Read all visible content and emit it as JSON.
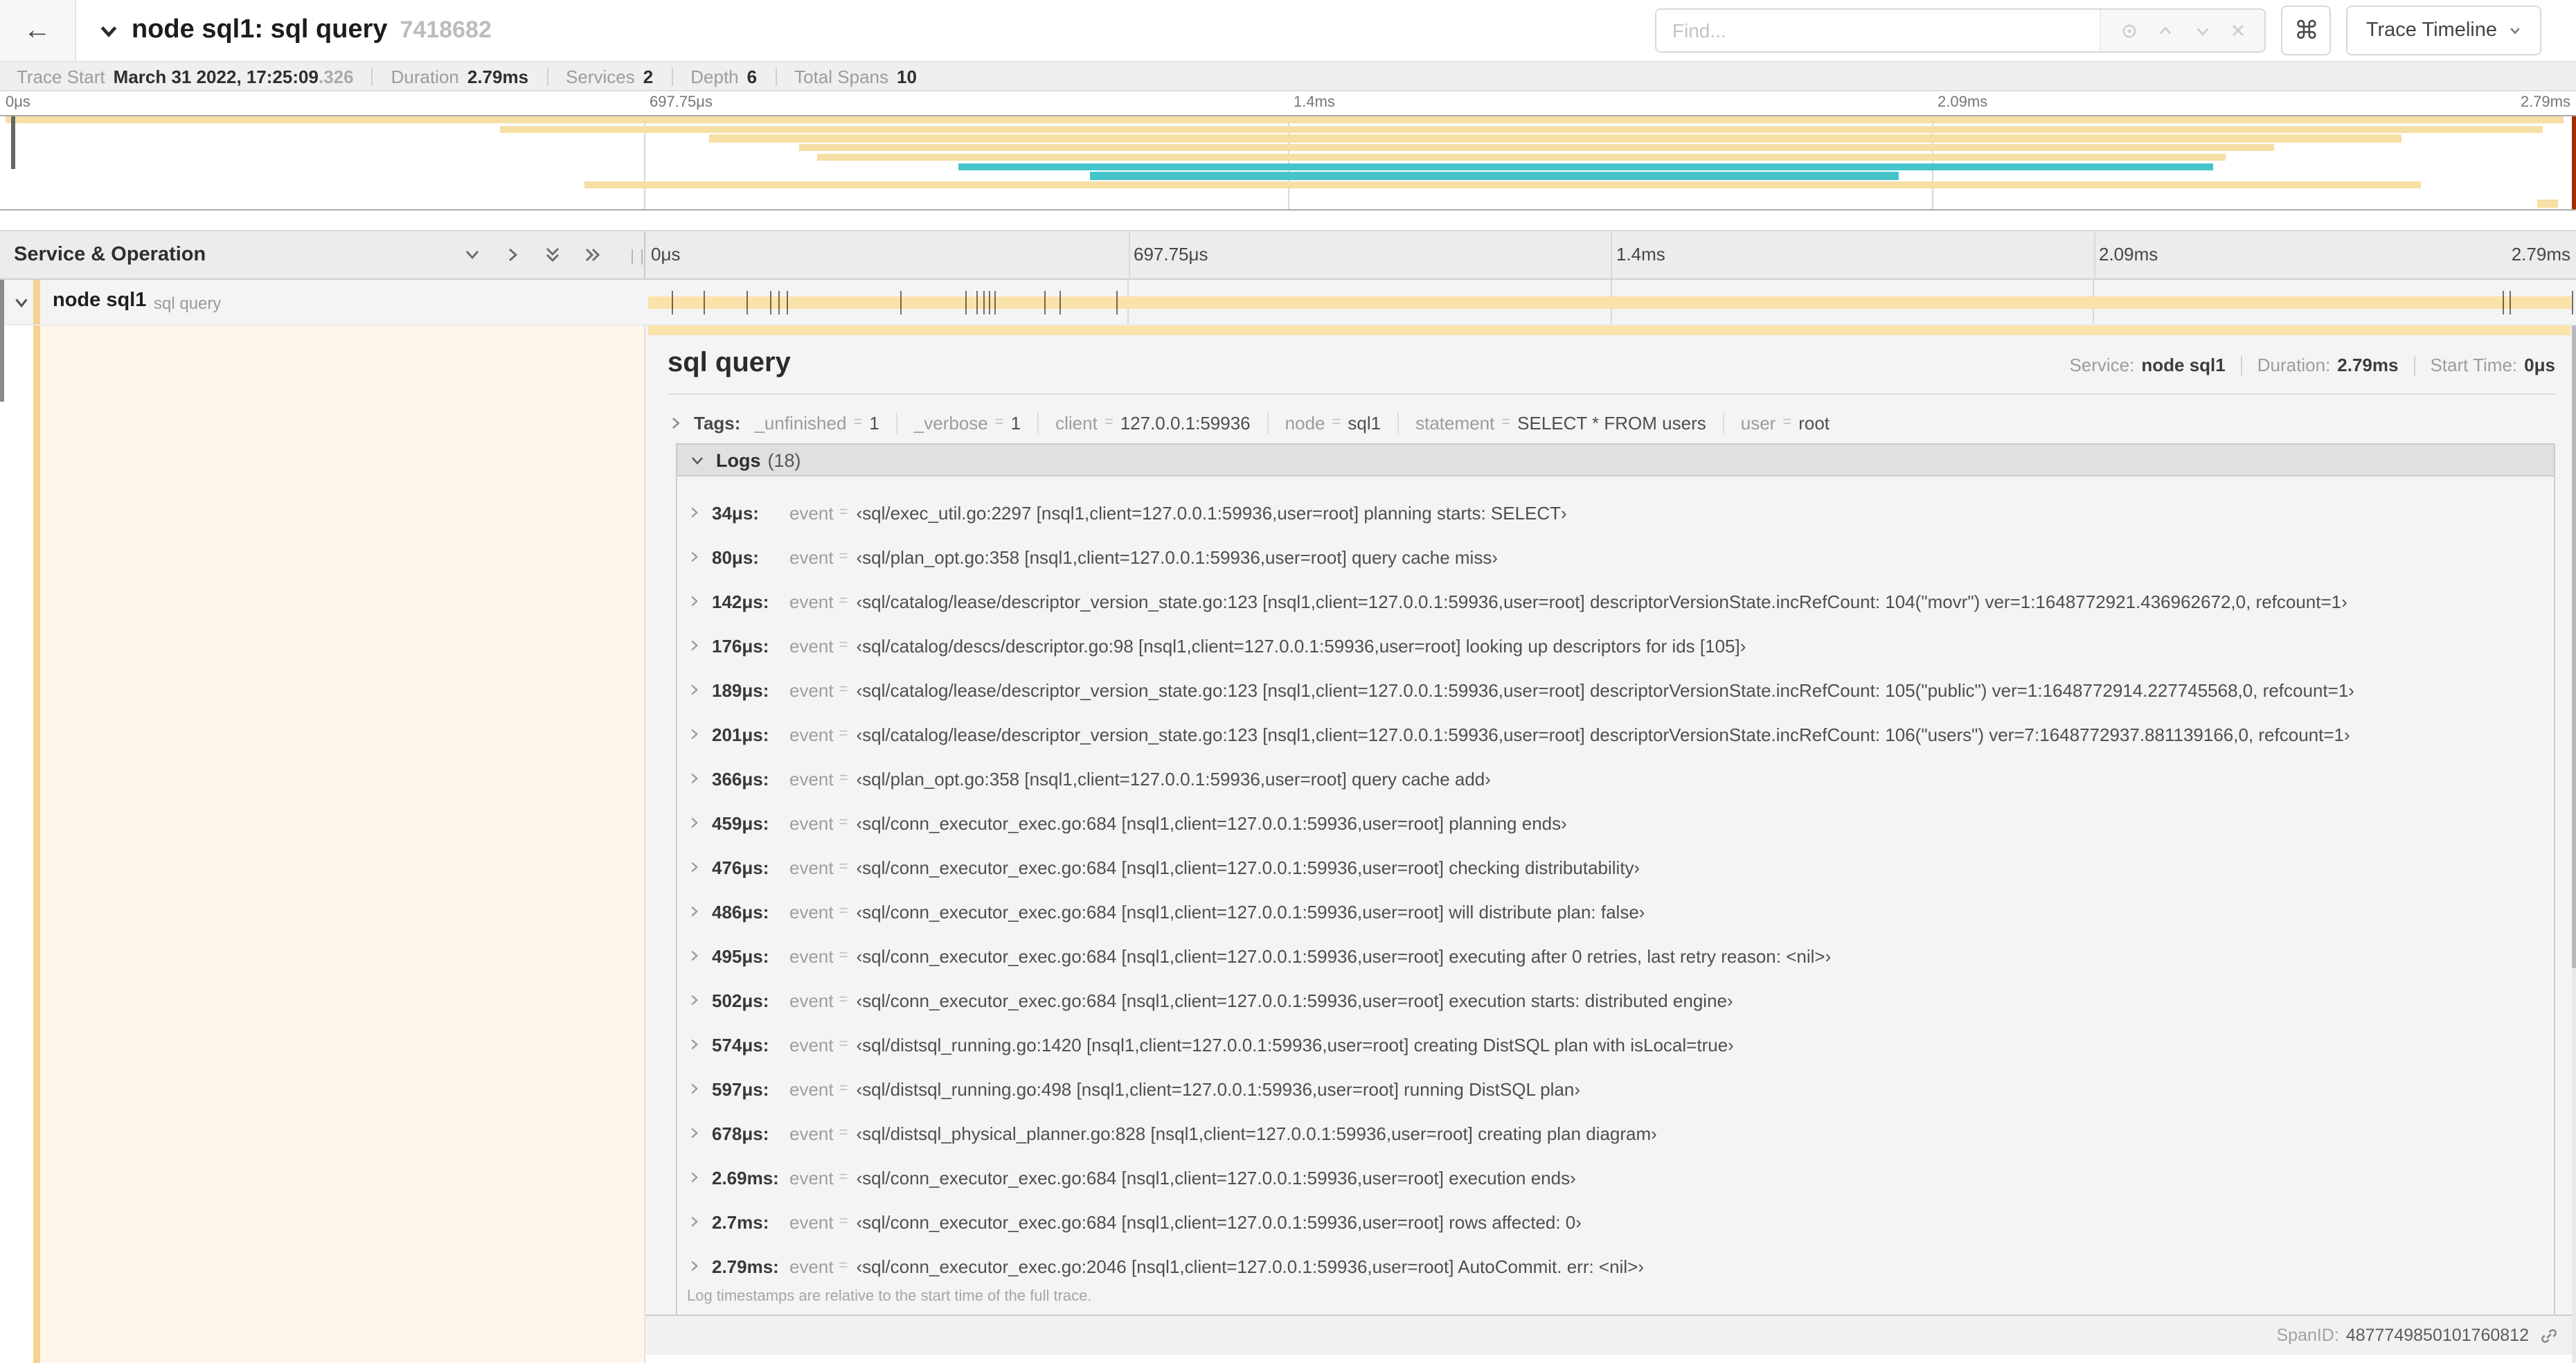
{
  "header": {
    "back": "←",
    "title": "node sql1: sql query",
    "trace_id": "7418682",
    "find_placeholder": "Find...",
    "shortcut_key": "⌘",
    "view_button": "Trace Timeline"
  },
  "stats": [
    {
      "label": "Trace Start",
      "value": "March 31 2022, 17:25:09",
      "suffix": ".326"
    },
    {
      "label": "Duration",
      "value": "2.79ms",
      "suffix": ""
    },
    {
      "label": "Services",
      "value": "2",
      "suffix": ""
    },
    {
      "label": "Depth",
      "value": "6",
      "suffix": ""
    },
    {
      "label": "Total Spans",
      "value": "10",
      "suffix": ""
    }
  ],
  "timeline": {
    "duration_us": 2790,
    "ticks": [
      {
        "label": "0μs",
        "pct": 0
      },
      {
        "label": "697.75μs",
        "pct": 25
      },
      {
        "label": "1.4ms",
        "pct": 50
      },
      {
        "label": "2.09ms",
        "pct": 75
      },
      {
        "label": "2.79ms",
        "pct": 100
      }
    ],
    "log_marks_us": [
      34,
      80,
      142,
      176,
      189,
      201,
      366,
      459,
      476,
      486,
      495,
      502,
      574,
      597,
      678,
      2690,
      2700,
      2790
    ]
  },
  "minimap": {
    "rows": [
      {
        "row": 1,
        "s": 0.2,
        "e": 99.5,
        "c": "y"
      },
      {
        "row": 2,
        "s": 19.4,
        "e": 98.7,
        "c": "y"
      },
      {
        "row": 3,
        "s": 27.5,
        "e": 93.2,
        "c": "y"
      },
      {
        "row": 4,
        "s": 31.0,
        "e": 88.3,
        "c": "y"
      },
      {
        "row": 5,
        "s": 31.7,
        "e": 86.4,
        "c": "y"
      },
      {
        "row": 6,
        "s": 37.2,
        "e": 85.9,
        "c": "t"
      },
      {
        "row": 7,
        "s": 42.3,
        "e": 73.7,
        "c": "t"
      },
      {
        "row": 8,
        "s": 22.7,
        "e": 94.0,
        "c": "y"
      },
      {
        "row": 10,
        "s": 98.5,
        "e": 99.3,
        "c": "y"
      }
    ]
  },
  "tree": {
    "header": "Service & Operation",
    "row": {
      "service": "node sql1",
      "operation": "sql query"
    }
  },
  "detail": {
    "title": "sql query",
    "info": [
      {
        "label": "Service:",
        "value": "node sql1"
      },
      {
        "label": "Duration:",
        "value": "2.79ms"
      },
      {
        "label": "Start Time:",
        "value": "0μs"
      }
    ],
    "tags_label": "Tags:",
    "tags": [
      {
        "k": "_unfinished",
        "v": "1"
      },
      {
        "k": "_verbose",
        "v": "1"
      },
      {
        "k": "client",
        "v": "127.0.0.1:59936"
      },
      {
        "k": "node",
        "v": "sql1"
      },
      {
        "k": "statement",
        "v": "SELECT * FROM users"
      },
      {
        "k": "user",
        "v": "root"
      }
    ],
    "logs_title": "Logs",
    "logs_count": "(18)",
    "log_key": "event",
    "log_eq": "=",
    "logs": [
      {
        "t": "34μs:",
        "v": "‹sql/exec_util.go:2297 [nsql1,client=127.0.0.1:59936,user=root] planning starts: SELECT›"
      },
      {
        "t": "80μs:",
        "v": "‹sql/plan_opt.go:358 [nsql1,client=127.0.0.1:59936,user=root] query cache miss›"
      },
      {
        "t": "142μs:",
        "v": "‹sql/catalog/lease/descriptor_version_state.go:123 [nsql1,client=127.0.0.1:59936,user=root] descriptorVersionState.incRefCount: 104(\"movr\") ver=1:1648772921.436962672,0, refcount=1›"
      },
      {
        "t": "176μs:",
        "v": "‹sql/catalog/descs/descriptor.go:98 [nsql1,client=127.0.0.1:59936,user=root] looking up descriptors for ids [105]›"
      },
      {
        "t": "189μs:",
        "v": "‹sql/catalog/lease/descriptor_version_state.go:123 [nsql1,client=127.0.0.1:59936,user=root] descriptorVersionState.incRefCount: 105(\"public\") ver=1:1648772914.227745568,0, refcount=1›"
      },
      {
        "t": "201μs:",
        "v": "‹sql/catalog/lease/descriptor_version_state.go:123 [nsql1,client=127.0.0.1:59936,user=root] descriptorVersionState.incRefCount: 106(\"users\") ver=7:1648772937.881139166,0, refcount=1›"
      },
      {
        "t": "366μs:",
        "v": "‹sql/plan_opt.go:358 [nsql1,client=127.0.0.1:59936,user=root] query cache add›"
      },
      {
        "t": "459μs:",
        "v": "‹sql/conn_executor_exec.go:684 [nsql1,client=127.0.0.1:59936,user=root] planning ends›"
      },
      {
        "t": "476μs:",
        "v": "‹sql/conn_executor_exec.go:684 [nsql1,client=127.0.0.1:59936,user=root] checking distributability›"
      },
      {
        "t": "486μs:",
        "v": "‹sql/conn_executor_exec.go:684 [nsql1,client=127.0.0.1:59936,user=root] will distribute plan: false›"
      },
      {
        "t": "495μs:",
        "v": "‹sql/conn_executor_exec.go:684 [nsql1,client=127.0.0.1:59936,user=root] executing after 0 retries, last retry reason: <nil>›"
      },
      {
        "t": "502μs:",
        "v": "‹sql/conn_executor_exec.go:684 [nsql1,client=127.0.0.1:59936,user=root] execution starts: distributed engine›"
      },
      {
        "t": "574μs:",
        "v": "‹sql/distsql_running.go:1420 [nsql1,client=127.0.0.1:59936,user=root] creating DistSQL plan with isLocal=true›"
      },
      {
        "t": "597μs:",
        "v": "‹sql/distsql_running.go:498 [nsql1,client=127.0.0.1:59936,user=root] running DistSQL plan›"
      },
      {
        "t": "678μs:",
        "v": "‹sql/distsql_physical_planner.go:828 [nsql1,client=127.0.0.1:59936,user=root] creating plan diagram›"
      },
      {
        "t": "2.69ms:",
        "v": "‹sql/conn_executor_exec.go:684 [nsql1,client=127.0.0.1:59936,user=root] execution ends›"
      },
      {
        "t": "2.7ms:",
        "v": "‹sql/conn_executor_exec.go:684 [nsql1,client=127.0.0.1:59936,user=root] rows affected: 0›"
      },
      {
        "t": "2.79ms:",
        "v": "‹sql/conn_executor_exec.go:2046 [nsql1,client=127.0.0.1:59936,user=root] AutoCommit. err: <nil>›"
      }
    ],
    "footer_note": "Log timestamps are relative to the start time of the full trace.",
    "span_id_label": "SpanID:",
    "span_id": "4877749850101760812"
  },
  "colors": {
    "span_yellow": "#f6dfa4",
    "span_teal": "#45c5c9",
    "row_accent": "#f6d28e",
    "detail_cream": "#fff6eb"
  }
}
